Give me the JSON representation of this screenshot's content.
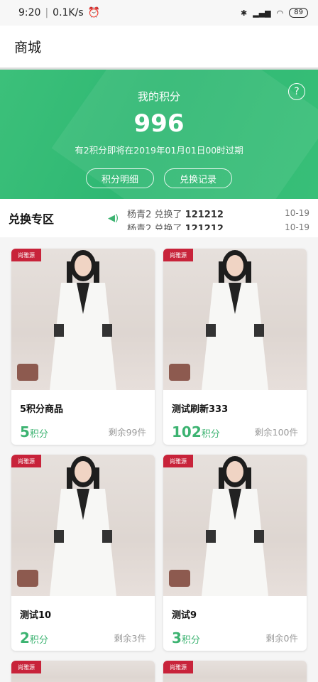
{
  "status_bar": {
    "time": "9:20",
    "speed": "0.1K/s",
    "battery": "89"
  },
  "app_bar": {
    "title": "商城"
  },
  "points_card": {
    "title": "我的积分",
    "points": "996",
    "expire_note": "有2积分即将在2019年01月01日00时过期",
    "detail_button": "积分明细",
    "history_button": "兑换记录"
  },
  "exchange": {
    "title": "兑换专区",
    "ticker": [
      {
        "user": "杨青2",
        "action": "兑换了",
        "item": "121212",
        "date": "10-19"
      },
      {
        "user": "杨青2",
        "action": "兑换了",
        "item": "121212",
        "date": "10-19"
      }
    ]
  },
  "products": [
    {
      "name": "5积分商品",
      "points": "5",
      "unit": "积分",
      "stock": "剩余99件"
    },
    {
      "name": "测试刷新333",
      "points": "102",
      "unit": "积分",
      "stock": "剩余100件"
    },
    {
      "name": "测试10",
      "points": "2",
      "unit": "积分",
      "stock": "剩余3件"
    },
    {
      "name": "测试9",
      "points": "3",
      "unit": "积分",
      "stock": "剩余0件"
    }
  ],
  "colors": {
    "accent": "#3cb371",
    "hero": "#33b874"
  }
}
